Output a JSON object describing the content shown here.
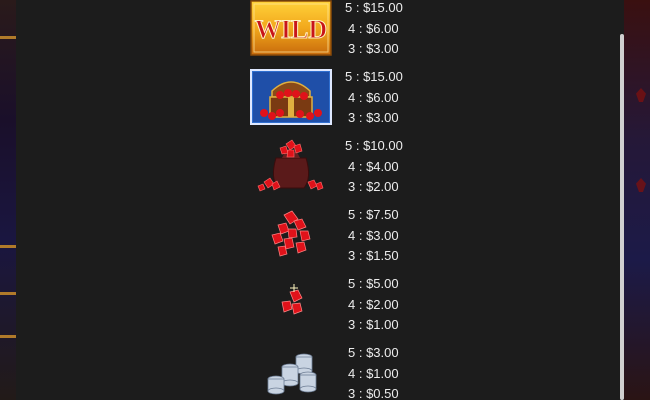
{
  "paytable": {
    "rows": [
      {
        "symbol": "wild",
        "symbol_text": "WILD",
        "pays": [
          {
            "count": "5",
            "sep": " : ",
            "amount": "$15.00"
          },
          {
            "count": "4",
            "sep": " : ",
            "amount": "$6.00"
          },
          {
            "count": "3",
            "sep": " : ",
            "amount": "$3.00"
          }
        ]
      },
      {
        "symbol": "treasure-chest",
        "pays": [
          {
            "count": "5",
            "sep": " : ",
            "amount": "$15.00"
          },
          {
            "count": "4",
            "sep": " : ",
            "amount": "$6.00"
          },
          {
            "count": "3",
            "sep": " : ",
            "amount": "$3.00"
          }
        ]
      },
      {
        "symbol": "gem-sack",
        "pays": [
          {
            "count": "5",
            "sep": " : ",
            "amount": "$10.00"
          },
          {
            "count": "4",
            "sep": " : ",
            "amount": "$4.00"
          },
          {
            "count": "3",
            "sep": " : ",
            "amount": "$2.00"
          }
        ]
      },
      {
        "symbol": "gem-pile",
        "pays": [
          {
            "count": "5",
            "sep": " : ",
            "amount": "$7.50"
          },
          {
            "count": "4",
            "sep": " : ",
            "amount": "$3.00"
          },
          {
            "count": "3",
            "sep": " : ",
            "amount": "$1.50"
          }
        ]
      },
      {
        "symbol": "gem-pair",
        "pays": [
          {
            "count": "5",
            "sep": " : ",
            "amount": "$5.00"
          },
          {
            "count": "4",
            "sep": " : ",
            "amount": "$2.00"
          },
          {
            "count": "3",
            "sep": " : ",
            "amount": "$1.00"
          }
        ]
      },
      {
        "symbol": "silver-coins",
        "pays": [
          {
            "count": "5",
            "sep": " : ",
            "amount": "$3.00"
          },
          {
            "count": "4",
            "sep": " : ",
            "amount": "$1.00"
          },
          {
            "count": "3",
            "sep": " : ",
            "amount": "$0.50"
          }
        ]
      }
    ]
  },
  "colors": {
    "panel_bg": "#1c1c1c",
    "text": "#ececec",
    "wild_gold": "#f2a81c",
    "wild_red": "#c8141a",
    "ruby": "#d8121a",
    "chest_blue": "#2f6fd0",
    "silver": "#c9d4e2"
  }
}
